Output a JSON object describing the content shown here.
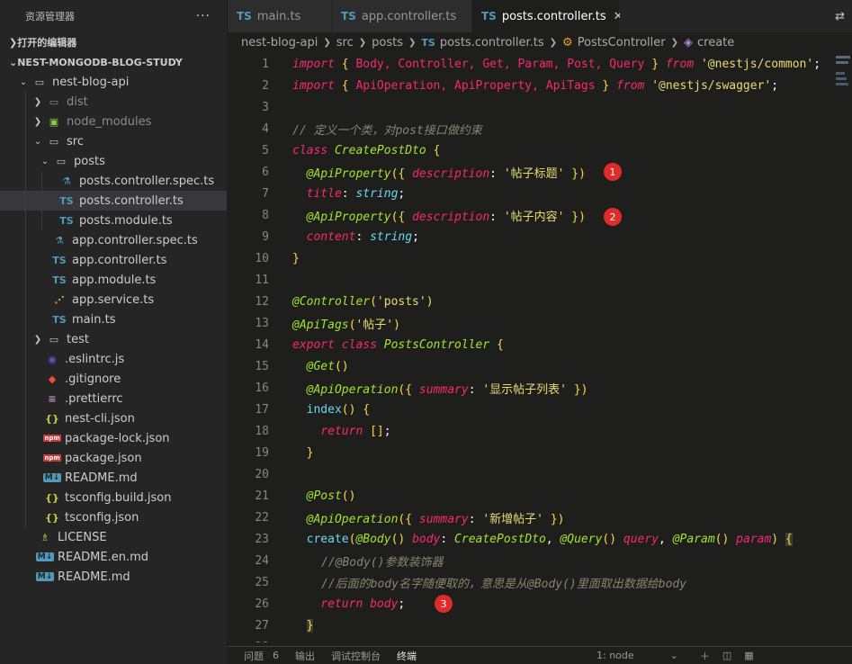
{
  "sidebar": {
    "title": "资源管理器",
    "more": "···",
    "open_editors": "打开的编辑器",
    "project": "NEST-MONGODB-BLOG-STUDY",
    "tree": [
      {
        "label": "nest-blog-api",
        "kind": "folder-open"
      },
      {
        "label": "dist",
        "kind": "folder"
      },
      {
        "label": "node_modules",
        "kind": "folder"
      },
      {
        "label": "src",
        "kind": "folder-open"
      },
      {
        "label": "posts",
        "kind": "folder-open"
      },
      {
        "label": "posts.controller.spec.ts",
        "kind": "spec"
      },
      {
        "label": "posts.controller.ts",
        "kind": "ts"
      },
      {
        "label": "posts.module.ts",
        "kind": "ts"
      },
      {
        "label": "app.controller.spec.ts",
        "kind": "spec"
      },
      {
        "label": "app.controller.ts",
        "kind": "ts"
      },
      {
        "label": "app.module.ts",
        "kind": "ts"
      },
      {
        "label": "app.service.ts",
        "kind": "service"
      },
      {
        "label": "main.ts",
        "kind": "ts"
      },
      {
        "label": "test",
        "kind": "folder"
      },
      {
        "label": ".eslintrc.js",
        "kind": "eslint"
      },
      {
        "label": ".gitignore",
        "kind": "git"
      },
      {
        "label": ".prettierrc",
        "kind": "prettier"
      },
      {
        "label": "nest-cli.json",
        "kind": "json"
      },
      {
        "label": "package-lock.json",
        "kind": "npm"
      },
      {
        "label": "package.json",
        "kind": "npm"
      },
      {
        "label": "README.md",
        "kind": "md"
      },
      {
        "label": "tsconfig.build.json",
        "kind": "json"
      },
      {
        "label": "tsconfig.json",
        "kind": "json"
      },
      {
        "label": "LICENSE",
        "kind": "license"
      },
      {
        "label": "README.en.md",
        "kind": "md"
      },
      {
        "label": "README.md",
        "kind": "md"
      }
    ]
  },
  "tabs": [
    {
      "icon": "TS",
      "label": "main.ts"
    },
    {
      "icon": "TS",
      "label": "app.controller.ts"
    },
    {
      "icon": "TS",
      "label": "posts.controller.ts",
      "close": "✕"
    }
  ],
  "breadcrumb": {
    "items": [
      "nest-blog-api",
      "src",
      "posts"
    ],
    "file": "posts.controller.ts",
    "class": "PostsController",
    "method": "create"
  },
  "code_lines": [
    "1",
    "2",
    "3",
    "4",
    "5",
    "6",
    "7",
    "8",
    "9",
    "10",
    "11",
    "12",
    "13",
    "14",
    "15",
    "16",
    "17",
    "18",
    "19",
    "20",
    "21",
    "22",
    "23",
    "24",
    "25",
    "26",
    "27",
    "28"
  ],
  "code": {
    "l1_imports": "Body, Controller, Get, Param, Post, Query",
    "l1_module": "'@nestjs/common'",
    "l2_imports": "ApiOperation, ApiProperty, ApiTags",
    "l2_module": "'@nestjs/swagger'",
    "l4_comment": "// 定义一个类，对post接口做约束",
    "l5_class": "CreatePostDto",
    "l6_desc": "'帖子标题'",
    "l7_field": "title",
    "l8_desc": "'帖子内容'",
    "l9_field": "content",
    "l12_route": "'posts'",
    "l13_tag": "'帖子'",
    "l14_class": "PostsController",
    "l16_summary": "'显示帖子列表'",
    "l17_method": "index",
    "l22_summary": "'新增帖子'",
    "l24_comment": "//@Body()参数装饰器",
    "l25_comment": "//后面的body名字随便取的，意思是从@Body()里面取出数据给body"
  },
  "badges": [
    "1",
    "2",
    "3"
  ],
  "panel": {
    "tabs": [
      "问题",
      "6",
      "输出",
      "调试控制台",
      "终端"
    ],
    "terminal": "1: node"
  }
}
